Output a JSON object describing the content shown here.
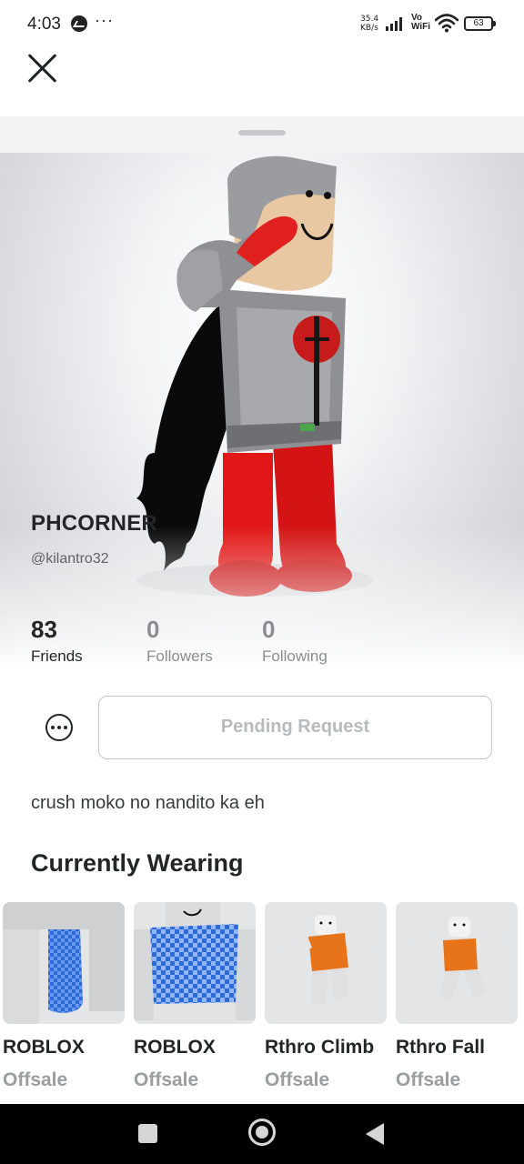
{
  "status_bar": {
    "time": "4:03",
    "more": "···",
    "speed_top": "35.4",
    "speed_bottom": "KB/s",
    "vo": "Vo",
    "wifi_label": "WiFi",
    "battery": "63"
  },
  "profile": {
    "display_name": "PHCORNER",
    "username": "@kilantro32",
    "bio": "crush moko no nandito ka eh"
  },
  "stats": [
    {
      "count": "83",
      "label": "Friends"
    },
    {
      "count": "0",
      "label": "Followers"
    },
    {
      "count": "0",
      "label": "Following"
    }
  ],
  "actions": {
    "pending_label": "Pending Request"
  },
  "wearing": {
    "title": "Currently Wearing",
    "items": [
      {
        "name": "ROBLOX",
        "price": "Offsale"
      },
      {
        "name": "ROBLOX",
        "price": "Offsale"
      },
      {
        "name": "Rthro Climb",
        "price": "Offsale"
      },
      {
        "name": "Rthro Fall",
        "price": "Offsale"
      }
    ]
  },
  "colors": {
    "accent_red": "#e01f1f",
    "text_primary": "#232527",
    "text_muted": "#9a9ca0",
    "item_blue": "#2f6bd8"
  }
}
